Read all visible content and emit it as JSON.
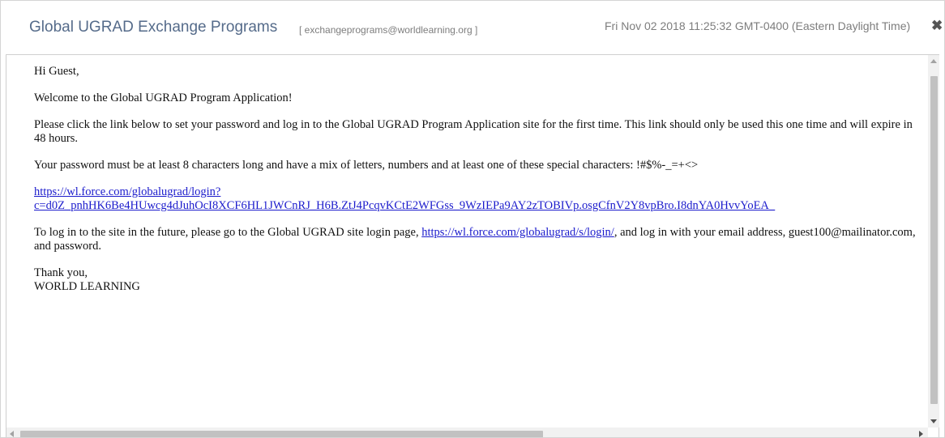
{
  "header": {
    "subject": "Global UGRAD Exchange Programs",
    "sender": "[ exchangeprograms@worldlearning.org ]",
    "date": "Fri Nov 02 2018 11:25:32 GMT-0400 (Eastern Daylight Time)",
    "close_icon": "close-icon",
    "close_glyph": "✖"
  },
  "email": {
    "greeting": "Hi Guest,",
    "welcome": "Welcome to the Global UGRAD Program Application!",
    "instructions": "Please click the link below to set your password and log in to the Global UGRAD Program Application site for the first time. This link should only be used this one time and will expire in 48 hours.",
    "password_rules": "Your password must be at least 8 characters long and have a mix of letters, numbers and at least one of these special characters: !#$%-_=+<>",
    "reset_link_line1": "https://wl.force.com/globalugrad/login?",
    "reset_link_line2": "c=d0Z_pnhHK6Be4HUwcg4dJuhOcI8XCF6HL1JWCnRJ_H6B.ZtJ4PcqvKCtE2WFGss_9WzIEPa9AY2zTOBIVp.osgCfnV2Y8vpBro.I8dnYA0HvvYoEA_",
    "future_login_before": "To log in to the site in the future, please go to the Global UGRAD site login page, ",
    "future_login_link": "https://wl.force.com/globalugrad/s/login/",
    "future_login_after": ", and log in with your email address, guest100@mailinator.com, and password.",
    "closing": "Thank you,",
    "signature": "WORLD LEARNING"
  }
}
